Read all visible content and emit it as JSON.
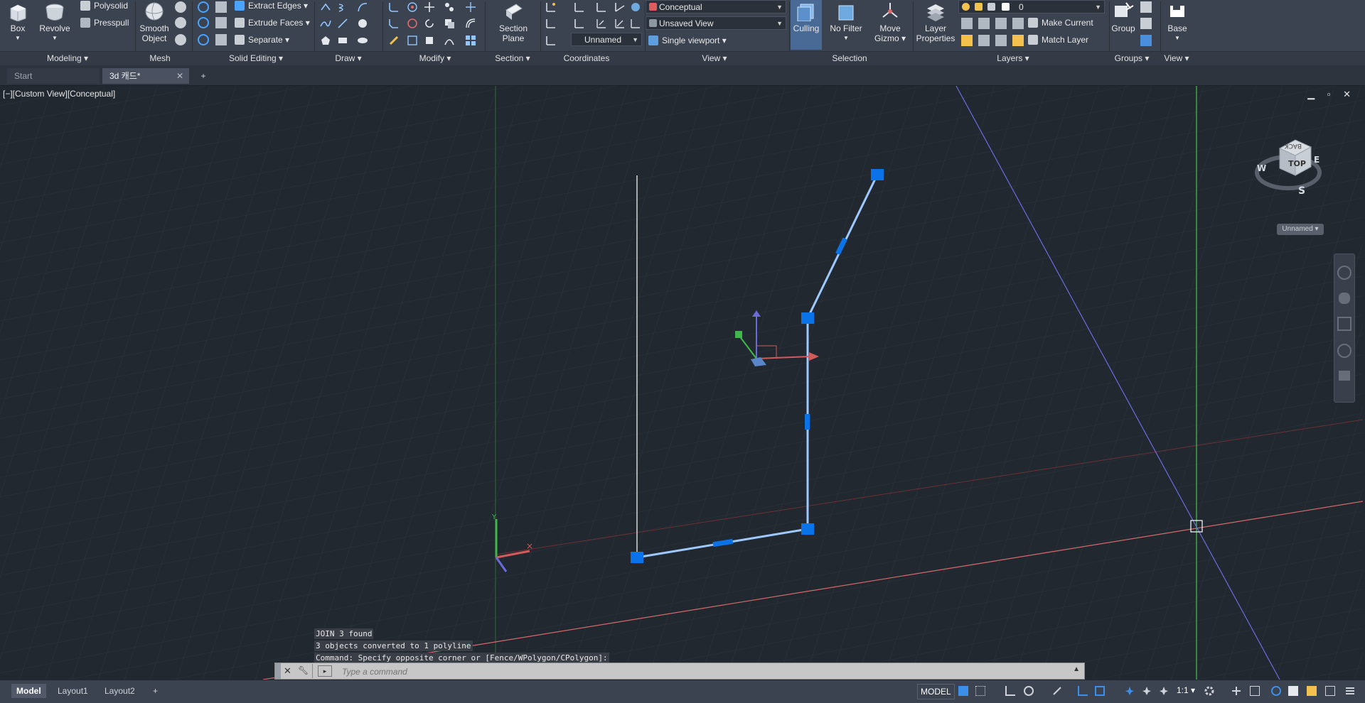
{
  "colors": {
    "accent": "#1e88ff",
    "grip": "#0a73e8",
    "x_axis": "#d25a5a",
    "y_axis": "#3fb84b",
    "z_axis": "#6a6adc"
  },
  "ribbon": {
    "panels": [
      "Modeling",
      "Mesh",
      "Solid Editing",
      "Draw",
      "Modify",
      "Section",
      "Coordinates",
      "View",
      "Selection",
      "Layers",
      "Groups",
      "View"
    ],
    "box": "Box",
    "revolve": "Revolve",
    "polysolid": "Polysolid",
    "presspull": "Presspull",
    "smooth_object_1": "Smooth",
    "smooth_object_2": "Object",
    "extract_edges": "Extract Edges",
    "extrude_faces": "Extrude Faces",
    "separate": "Separate",
    "section_plane_1": "Section",
    "section_plane_2": "Plane",
    "visual_style": "Conceptual",
    "saved_view": "Unsaved View",
    "ucs_named": "Unnamed",
    "viewport_config": "Single viewport",
    "culling": "Culling",
    "no_filter": "No Filter",
    "move_gizmo_1": "Move",
    "move_gizmo_2": "Gizmo",
    "layer_properties_1": "Layer",
    "layer_properties_2": "Properties",
    "layer_current": "0",
    "make_current": "Make Current",
    "match_layer": "Match Layer",
    "group": "Group",
    "base": "Base"
  },
  "tabs": {
    "start": "Start",
    "drawing": "3d 캐드*"
  },
  "viewport": {
    "label": "[−][Custom View][Conceptual]",
    "viewcube_top": "TOP",
    "viewcube_back": "BACK",
    "compass": {
      "w": "W",
      "e": "E",
      "s": "S"
    },
    "wcs_menu": "Unnamed",
    "window_controls": "▁ ▫ ✕"
  },
  "command": {
    "history": [
      "JOIN 3 found",
      "3 objects converted to 1 polyline",
      "Command: Specify opposite corner or [Fence/WPolygon/CPolygon]:"
    ],
    "placeholder": "Type a command"
  },
  "layouts": [
    "Model",
    "Layout1",
    "Layout2"
  ],
  "status": {
    "mode": "MODEL",
    "scale": "1:1"
  }
}
